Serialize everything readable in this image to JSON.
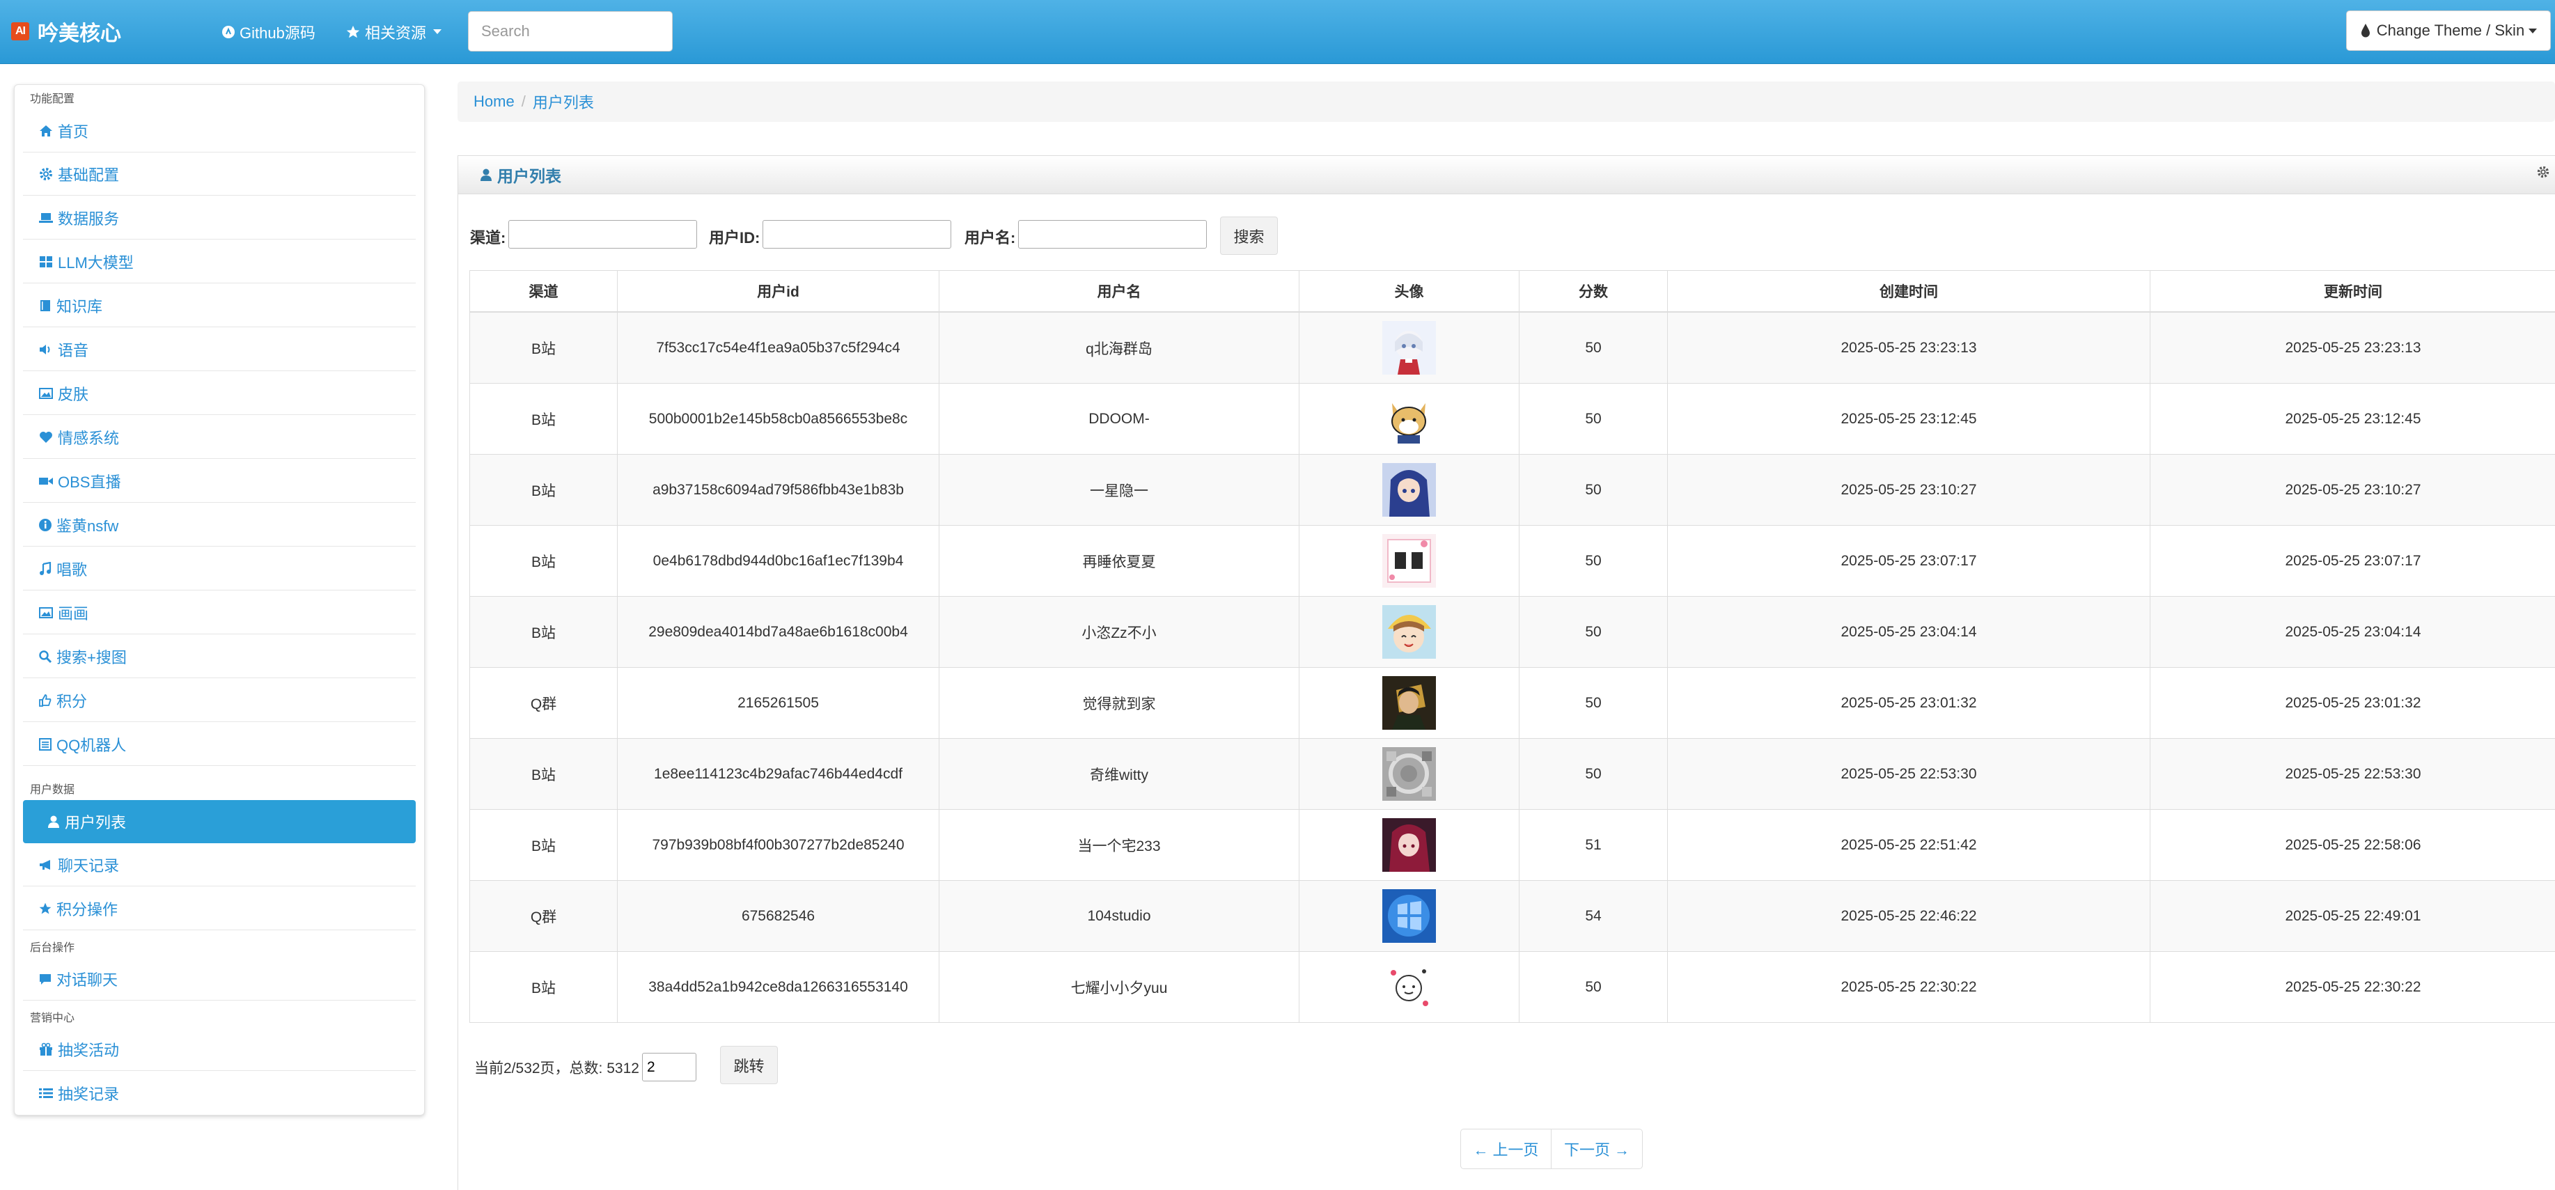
{
  "app": {
    "logo_text": "AI",
    "title": "吟美核心"
  },
  "navbar": {
    "github_label": "Github源码",
    "resources_label": "相关资源",
    "search_placeholder": "Search",
    "theme_label": "Change Theme / Skin"
  },
  "sidebar": {
    "sections": [
      {
        "label": "功能配置"
      },
      {
        "label": "用户数据"
      },
      {
        "label": "后台操作"
      },
      {
        "label": "营销中心"
      }
    ],
    "items": [
      {
        "label": "首页",
        "icon": "home-icon"
      },
      {
        "label": "基础配置",
        "icon": "gear-icon"
      },
      {
        "label": "数据服务",
        "icon": "laptop-icon"
      },
      {
        "label": "LLM大模型",
        "icon": "grid-icon"
      },
      {
        "label": "知识库",
        "icon": "book-icon"
      },
      {
        "label": "语音",
        "icon": "speaker-icon"
      },
      {
        "label": "皮肤",
        "icon": "picture-icon"
      },
      {
        "label": "情感系统",
        "icon": "heart-icon"
      },
      {
        "label": "OBS直播",
        "icon": "video-icon"
      },
      {
        "label": "鉴黄nsfw",
        "icon": "info-icon"
      },
      {
        "label": "唱歌",
        "icon": "music-icon"
      },
      {
        "label": "画画",
        "icon": "picture-icon"
      },
      {
        "label": "搜索+搜图",
        "icon": "search-icon"
      },
      {
        "label": "积分",
        "icon": "thumbs-up-icon"
      },
      {
        "label": "QQ机器人",
        "icon": "list-alt-icon"
      },
      {
        "label": "用户列表",
        "icon": "user-icon",
        "active": true
      },
      {
        "label": "聊天记录",
        "icon": "bullhorn-icon"
      },
      {
        "label": "积分操作",
        "icon": "star-icon"
      },
      {
        "label": "对话聊天",
        "icon": "comment-icon"
      },
      {
        "label": "抽奖活动",
        "icon": "gift-icon"
      },
      {
        "label": "抽奖记录",
        "icon": "list-icon"
      }
    ]
  },
  "breadcrumb": {
    "home": "Home",
    "current": "用户列表"
  },
  "panel": {
    "title": "用户列表"
  },
  "filters": {
    "channel_label": "渠道:",
    "channel_value": "",
    "userid_label": "用户ID:",
    "userid_value": "",
    "username_label": "用户名:",
    "username_value": "",
    "search_button": "搜索"
  },
  "table": {
    "columns": [
      "渠道",
      "用户id",
      "用户名",
      "头像",
      "分数",
      "创建时间",
      "更新时间"
    ],
    "rows": [
      {
        "channel": "B站",
        "userid": "7f53cc17c54e4f1ea9a05b37c5f294c4",
        "username": "q北海群岛",
        "avatar": "avatar-white-hair-girl",
        "score": "50",
        "created": "2025-05-25 23:23:13",
        "updated": "2025-05-25 23:23:13"
      },
      {
        "channel": "B站",
        "userid": "500b0001b2e145b58cb0a8566553be8c",
        "username": "DDOOM-",
        "avatar": "avatar-shiba-dog",
        "score": "50",
        "created": "2025-05-25 23:12:45",
        "updated": "2025-05-25 23:12:45"
      },
      {
        "channel": "B站",
        "userid": "a9b37158c6094ad79f586fbb43e1b83b",
        "username": "一星隐一",
        "avatar": "avatar-blue-hair-girl",
        "score": "50",
        "created": "2025-05-25 23:10:27",
        "updated": "2025-05-25 23:10:27"
      },
      {
        "channel": "B站",
        "userid": "0e4b6178dbd944d0bc16af1ec7f139b4",
        "username": "再睡依夏夏",
        "avatar": "avatar-pink-text",
        "score": "50",
        "created": "2025-05-25 23:07:17",
        "updated": "2025-05-25 23:07:17"
      },
      {
        "channel": "B站",
        "userid": "29e809dea4014bd7a48ae6b1618c00b4",
        "username": "小恣Zz不小",
        "avatar": "avatar-smiling-girl",
        "score": "50",
        "created": "2025-05-25 23:04:14",
        "updated": "2025-05-25 23:04:14"
      },
      {
        "channel": "Q群",
        "userid": "2165261505",
        "username": "觉得就到家",
        "avatar": "avatar-dark-character",
        "score": "50",
        "created": "2025-05-25 23:01:32",
        "updated": "2025-05-25 23:01:32"
      },
      {
        "channel": "B站",
        "userid": "1e8ee114123c4b29afac746b44ed4cdf",
        "username": "奇维witty",
        "avatar": "avatar-gray-pattern",
        "score": "50",
        "created": "2025-05-25 22:53:30",
        "updated": "2025-05-25 22:53:30"
      },
      {
        "channel": "B站",
        "userid": "797b939b08bf4f00b307277b2de85240",
        "username": "当一个宅233",
        "avatar": "avatar-red-hair-girl",
        "score": "51",
        "created": "2025-05-25 22:51:42",
        "updated": "2025-05-25 22:58:06"
      },
      {
        "channel": "Q群",
        "userid": "675682546",
        "username": "104studio",
        "avatar": "avatar-blue-windows",
        "score": "54",
        "created": "2025-05-25 22:46:22",
        "updated": "2025-05-25 22:49:01"
      },
      {
        "channel": "B站",
        "userid": "38a4dd52a1b942ce8da1266316553140",
        "username": "七耀小小夕yuu",
        "avatar": "avatar-doodle",
        "score": "50",
        "created": "2025-05-25 22:30:22",
        "updated": "2025-05-25 22:30:22"
      }
    ]
  },
  "pagination": {
    "summary": "当前2/532页，总数:  5312",
    "page_input": "2",
    "jump_button": "跳转",
    "prev_label": "← 上一页",
    "next_label": "下一页 →"
  },
  "colors": {
    "navbar": "#2a99d6",
    "link": "#2a90d6",
    "active_item": "#2a9fd8"
  }
}
